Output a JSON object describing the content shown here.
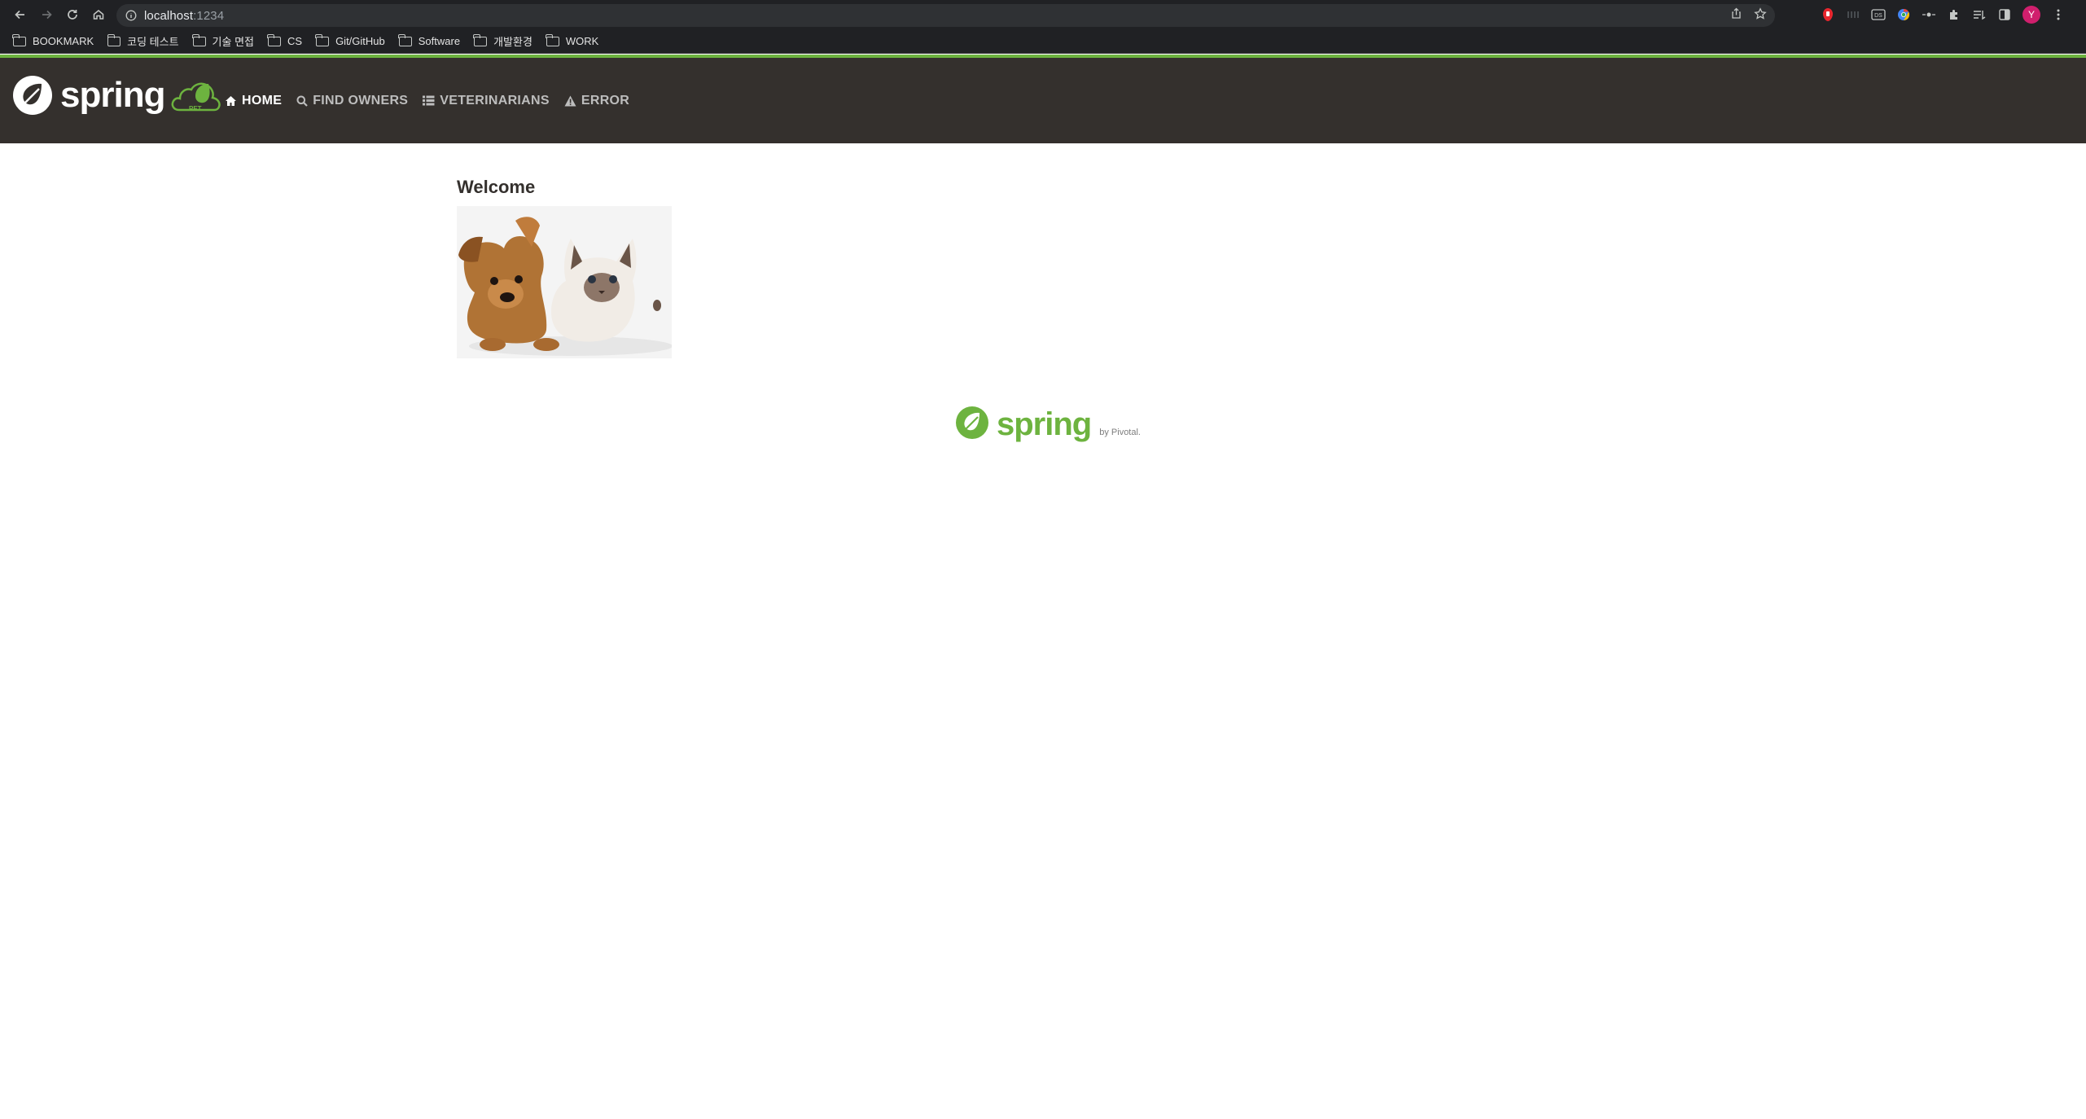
{
  "browser": {
    "url_host": "localhost",
    "url_port": ":1234",
    "avatar_initial": "Y",
    "bookmarks": [
      "BOOKMARK",
      "코딩 테스트",
      "기술 면접",
      "CS",
      "Git/GitHub",
      "Software",
      "개발환경",
      "WORK"
    ]
  },
  "app": {
    "brand": "spring",
    "menu": [
      {
        "label": "HOME",
        "icon": "home-icon",
        "active": true
      },
      {
        "label": "FIND OWNERS",
        "icon": "search-icon",
        "active": false
      },
      {
        "label": "VETERINARIANS",
        "icon": "list-icon",
        "active": false
      },
      {
        "label": "ERROR",
        "icon": "warning-icon",
        "active": false
      }
    ],
    "welcome_heading": "Welcome",
    "footer_brand": "spring",
    "footer_by": "by Pivotal."
  },
  "colors": {
    "navbar_bg": "#34302d",
    "accent_green": "#6db33f"
  }
}
